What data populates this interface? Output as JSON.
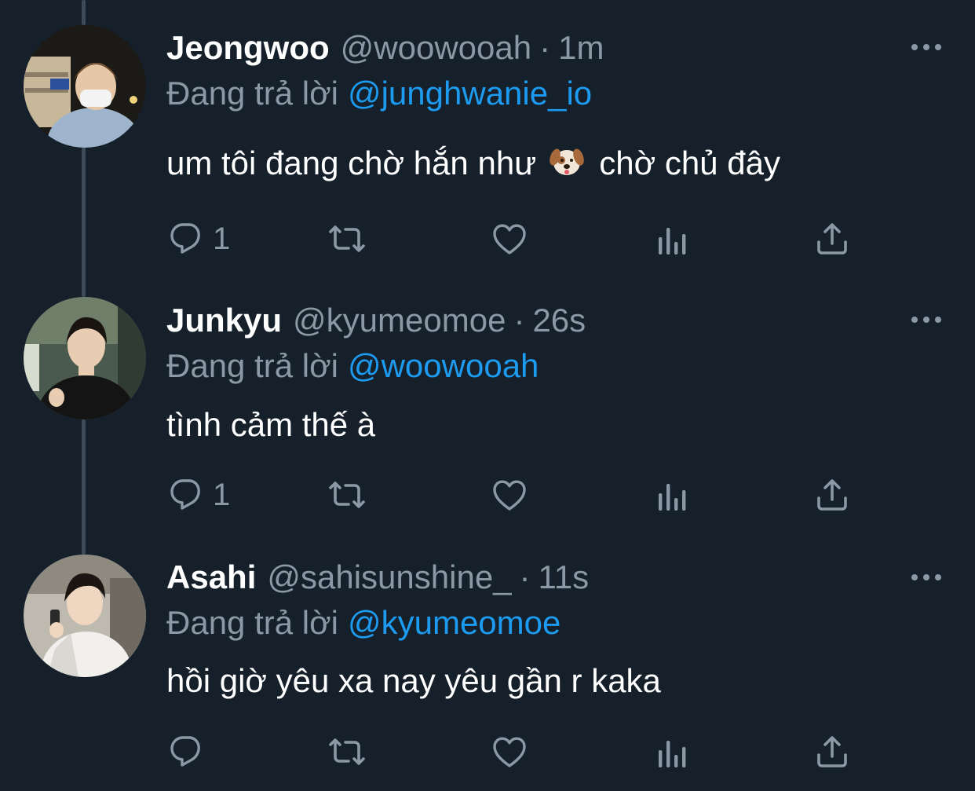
{
  "colors": {
    "background": "#15202b",
    "muted": "#8b98a5",
    "link": "#1d9bf0",
    "thread_line": "#3d4a57"
  },
  "tweets": [
    {
      "display_name": "Jeongwoo",
      "handle": "@woowooah",
      "separator": "·",
      "time": "1m",
      "replying_label": "Đang trả lời",
      "replying_to": "@junghwanie_io",
      "text_before_emoji": "um tôi đang chờ hắn như",
      "emoji": "dog-face",
      "text_after_emoji": "chờ chủ đây",
      "actions": {
        "reply_count": "1",
        "retweet_count": "",
        "like_count": ""
      }
    },
    {
      "display_name": "Junkyu",
      "handle": "@kyumeomoe",
      "separator": "·",
      "time": "26s",
      "replying_label": "Đang trả lời",
      "replying_to": "@woowooah",
      "text": "tình cảm thế à",
      "actions": {
        "reply_count": "1",
        "retweet_count": "",
        "like_count": ""
      }
    },
    {
      "display_name": "Asahi",
      "handle": "@sahisunshine_",
      "separator": "·",
      "time": "11s",
      "replying_label": "Đang trả lời",
      "replying_to": "@kyumeomoe",
      "text": "hồi giờ yêu xa nay yêu gần r kaka",
      "actions": {
        "reply_count": "",
        "retweet_count": "",
        "like_count": ""
      }
    }
  ],
  "icons": [
    "reply-icon",
    "retweet-icon",
    "like-icon",
    "analytics-icon",
    "share-icon",
    "more-icon"
  ]
}
